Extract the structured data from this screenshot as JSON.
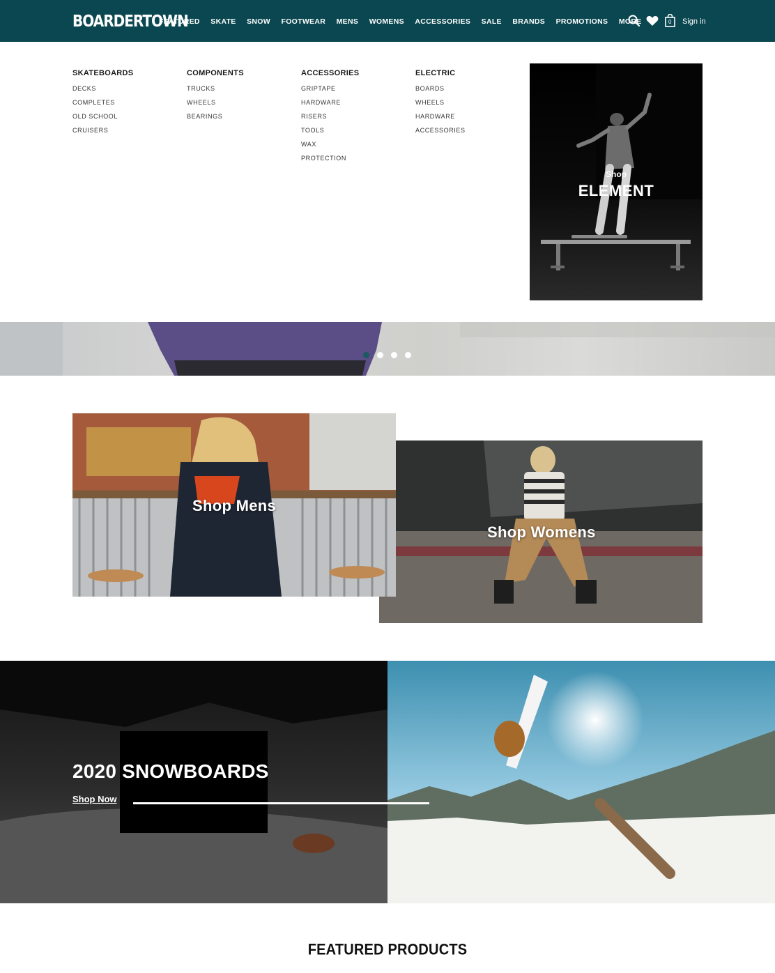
{
  "header": {
    "logo": "BOARDERTOWN",
    "nav": [
      "FEATURED",
      "SKATE",
      "SNOW",
      "FOOTWEAR",
      "MENS",
      "WOMENS",
      "ACCESSORIES",
      "SALE",
      "BRANDS",
      "PROMOTIONS",
      "MORE"
    ],
    "active_nav": "SKATE",
    "cart_count": "0",
    "sign_in": "Sign in",
    "icons": [
      "search-icon",
      "heart-icon",
      "cart-icon"
    ]
  },
  "mega_menu": {
    "columns": [
      {
        "title": "SKATEBOARDS",
        "links": [
          "DECKS",
          "COMPLETES",
          "OLD SCHOOL",
          "CRUISERS"
        ]
      },
      {
        "title": "COMPONENTS",
        "links": [
          "TRUCKS",
          "WHEELS",
          "BEARINGS"
        ]
      },
      {
        "title": "ACCESSORIES",
        "links": [
          "GRIPTAPE",
          "HARDWARE",
          "RISERS",
          "TOOLS",
          "WAX",
          "PROTECTION"
        ]
      },
      {
        "title": "ELECTRIC",
        "links": [
          "BOARDS",
          "WHEELS",
          "HARDWARE",
          "ACCESSORIES"
        ]
      }
    ],
    "promo": {
      "small": "Shop",
      "big": "ELEMENT"
    }
  },
  "hero": {
    "slide_count": 4,
    "active_slide": 1
  },
  "tiles": {
    "mens": "Shop Mens",
    "womens": "Shop Womens"
  },
  "snowboards": {
    "title": "2020 SNOWBOARDS",
    "cta": "Shop Now"
  },
  "featured": {
    "title": "FEATURED PRODUCTS"
  },
  "colors": {
    "header": "#0a4750",
    "active_dot": "#1c5a63"
  }
}
